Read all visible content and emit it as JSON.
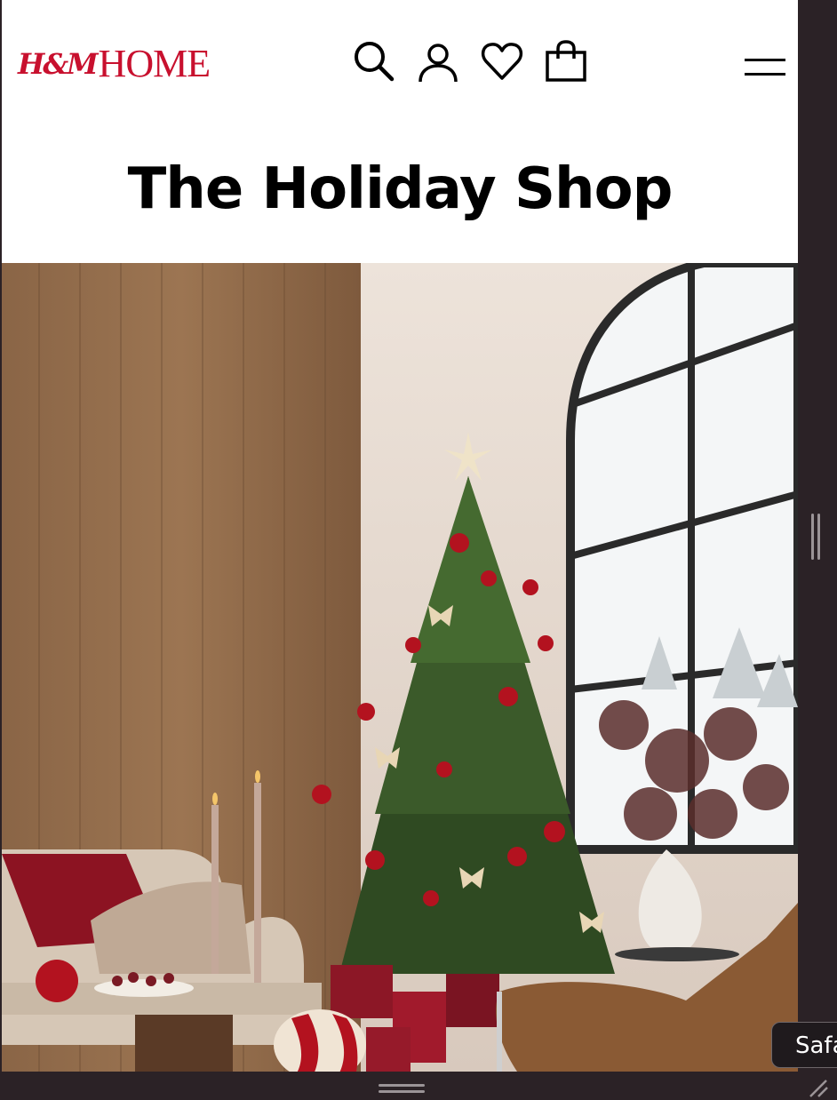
{
  "header": {
    "logo_hm": "H&M",
    "logo_home": "HOME",
    "icons": [
      "search-icon",
      "account-icon",
      "heart-icon",
      "shopping-bag-icon",
      "menu-icon"
    ]
  },
  "page": {
    "title": "The Holiday Shop"
  },
  "hero": {
    "description_icon": "holiday-living-room-image"
  },
  "window": {
    "tooltip": "Safari"
  },
  "colors": {
    "brand_red": "#c8102e",
    "text": "#000000",
    "frame": "#2b2226"
  }
}
